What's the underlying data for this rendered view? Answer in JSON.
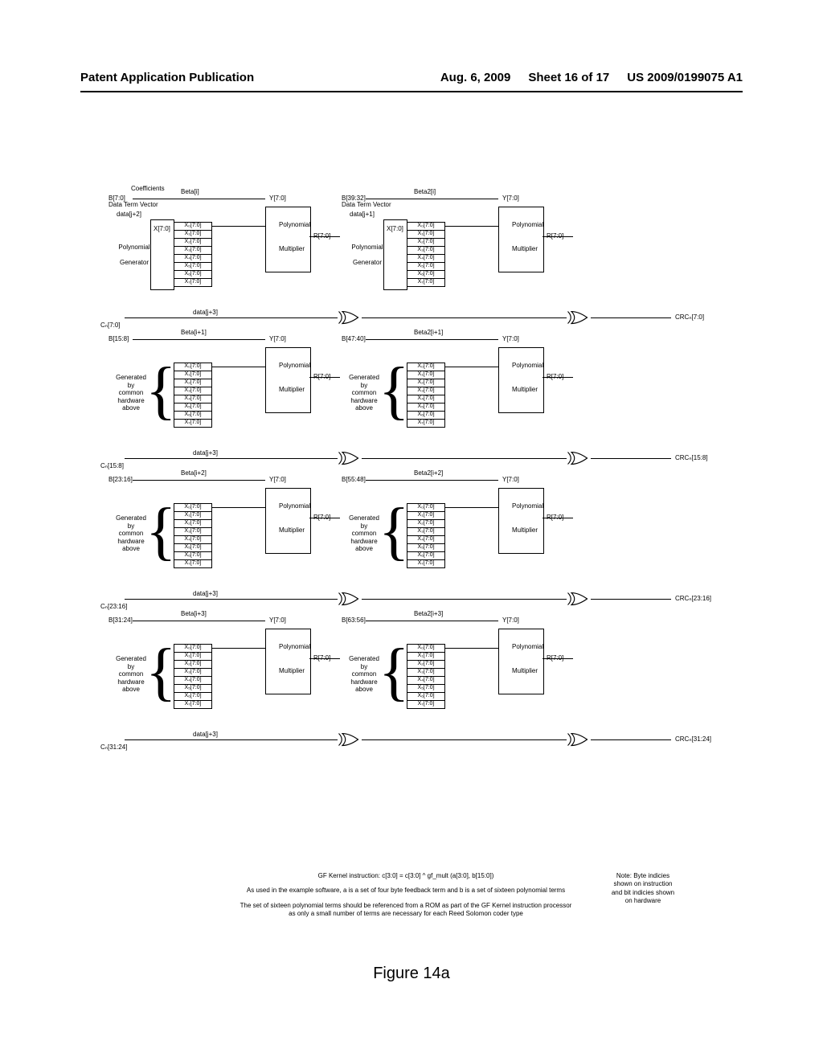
{
  "header": {
    "left": "Patent Application Publication",
    "date": "Aug. 6, 2009",
    "sheet": "Sheet 16 of 17",
    "pubno": "US 2009/0199075 A1"
  },
  "figure_caption": "Figure  14a",
  "footer": {
    "line1": "GF Kernel instruction: c[3:0] = c[3:0] ^ gf_mult (a[3:0], b[15:0])",
    "line2": "As used in the example software, a is a set of four byte feedback term and b is a set of sixteen polynomial terms",
    "line3": "The set of sixteen polynomial terms should be referenced from a ROM as part of the GF Kernel instruction processor as only a small number of terms are necessary for each Reed Solomon coder type",
    "note": "Note: Byte indicies shown on instruction and bit indicies shown on hardware"
  },
  "common": {
    "coef": "Coefficients",
    "dtv": "Data Term Vector",
    "x70": "X[7:0]",
    "y70": "Y[7:0]",
    "r70": "R[7:0]",
    "poly": "Polynomial",
    "mult": "Multiplier",
    "pg": "Polynomial",
    "gen": "Generator",
    "gen_common": "Generated by common hardware above",
    "xrows": [
      "X₀[7:0]",
      "X₁[7:0]",
      "X₂[7:0]",
      "X₃[7:0]",
      "X₄[7:0]",
      "X₅[7:0]",
      "X₆[7:0]",
      "X₇[7:0]"
    ]
  },
  "rows": [
    {
      "left": {
        "b": "B[7:0]",
        "beta": "Beta[i]",
        "data": "data[j+2]",
        "c": "Cₙ[7:0]",
        "data_xor": "data[j+3]",
        "first": true
      },
      "right": {
        "b": "B[39:32]",
        "beta": "Beta2[i]",
        "data": "data[j+1]",
        "crc": "CRCₙ[7:0]",
        "first": true
      }
    },
    {
      "left": {
        "b": "B[15:8]",
        "beta": "Beta[i+1]",
        "c": "Cₙ[15:8]",
        "data_xor": "data[j+3]",
        "first": false
      },
      "right": {
        "b": "B[47:40]",
        "beta": "Beta2[i+1]",
        "crc": "CRCₙ[15:8]",
        "first": false
      }
    },
    {
      "left": {
        "b": "B[23:16]",
        "beta": "Beta[i+2]",
        "c": "Cₙ[23:16]",
        "data_xor": "data[j+3]",
        "first": false
      },
      "right": {
        "b": "B[55:48]",
        "beta": "Beta2[i+2]",
        "crc": "CRCₙ[23:16]",
        "first": false
      }
    },
    {
      "left": {
        "b": "B[31:24]",
        "beta": "Beta[i+3]",
        "c": "Cₙ[31:24]",
        "data_xor": "data[j+3]",
        "first": false
      },
      "right": {
        "b": "B[63:56]",
        "beta": "Beta2[i+3]",
        "crc": "CRCₙ[31:24]",
        "first": false
      }
    }
  ]
}
